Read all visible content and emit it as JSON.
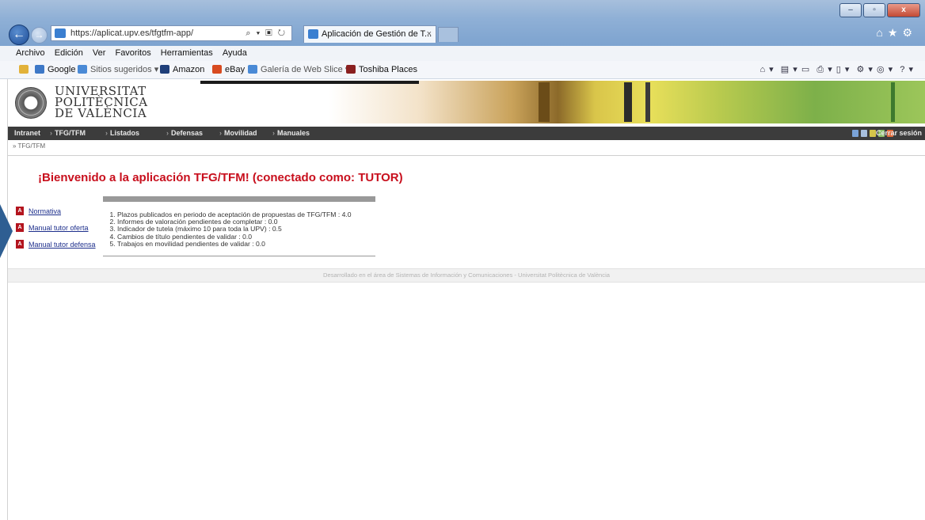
{
  "browser": {
    "url": "https://aplicat.upv.es/tfgtfm-app/",
    "tab_title": "Aplicación de Gestión de T...",
    "tab_close": "×",
    "menu": [
      "Archivo",
      "Edición",
      "Ver",
      "Favoritos",
      "Herramientas",
      "Ayuda"
    ],
    "favorites": [
      {
        "label": "Google",
        "style": "normal"
      },
      {
        "label": "Sitios sugeridos ▾",
        "style": "dim"
      },
      {
        "label": "Amazon",
        "style": "normal"
      },
      {
        "label": "eBay",
        "style": "normal"
      },
      {
        "label": "Galería de Web Slice ▾",
        "style": "dim"
      },
      {
        "label": "Toshiba Places",
        "style": "normal"
      }
    ]
  },
  "site": {
    "logo_lines": [
      "UNIVERSITAT",
      "POLITÈCNICA",
      "DE VALÈNCIA"
    ],
    "nav": [
      "Intranet",
      "TFG/TFM",
      "Listados",
      "Defensas",
      "Movilidad",
      "Manuales"
    ],
    "logout": "Cerrar sesión",
    "breadcrumb": "» TFG/TFM"
  },
  "main": {
    "welcome": "¡Bienvenido a la aplicación TFG/TFM! (conectado como: TUTOR)",
    "doc_links": [
      "Normativa",
      "Manual tutor oferta",
      "Manual tutor defensa"
    ],
    "summary": [
      "Plazos publicados en periodo de aceptación de propuestas de TFG/TFM : 4.0",
      "Informes de valoración pendientes de completar : 0.0",
      "Indicador de tutela (máximo 10 para toda la UPV) : 0.5",
      "Cambios de título pendientes de validar : 0.0",
      "Trabajos en movilidad pendientes de validar : 0.0"
    ]
  },
  "footer": "Desarrollado en el área de Sistemas de Información y Comunicaciones - Universitat Politècnica de València",
  "colors": {
    "welcome": "#c80f1d",
    "nav_bg": "#3c3c3c",
    "link": "#1d2f8c",
    "pdf": "#b3141e"
  }
}
